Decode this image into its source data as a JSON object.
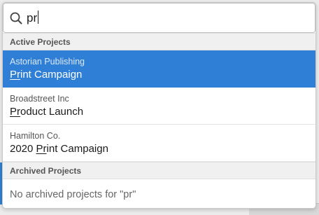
{
  "search": {
    "query": "pr",
    "icon": "search-icon"
  },
  "active_section": {
    "label": "Active Projects"
  },
  "results": [
    {
      "client": "Astorian Publishing",
      "project_match": "Pr",
      "project_rest": "int Campaign",
      "project_prefix": "",
      "selected": true
    },
    {
      "client": "Broadstreet Inc",
      "project_match": "Pr",
      "project_rest": "oduct Launch",
      "project_prefix": "",
      "selected": false
    },
    {
      "client": "Hamilton Co.",
      "project_prefix": "2020 ",
      "project_match": "Pr",
      "project_rest": "int Campaign",
      "selected": false
    }
  ],
  "archived_section": {
    "label": "Archived Projects",
    "empty_message": "No archived projects for \"pr\""
  },
  "colors": {
    "selected_bg": "#2f7fd6",
    "header_bg": "#f0f0f0"
  }
}
